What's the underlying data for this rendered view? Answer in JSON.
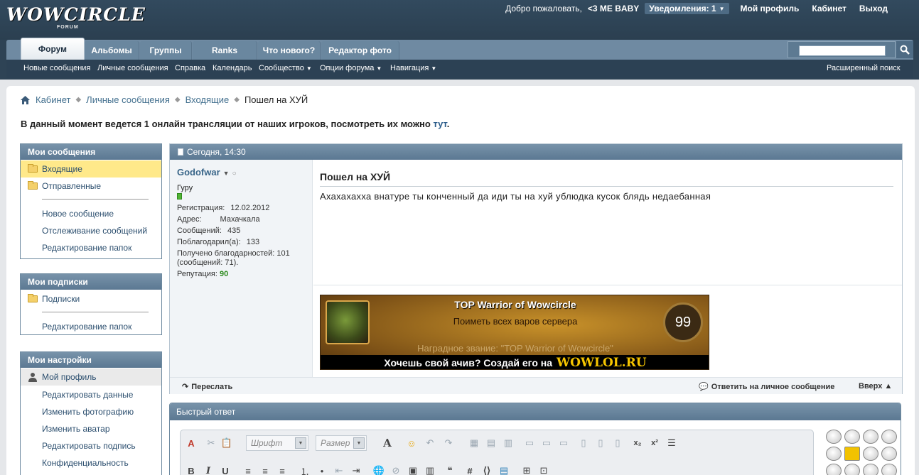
{
  "header": {
    "logo": "WOWCIRCLE",
    "logo_sub": "FORUM",
    "welcome": "Добро пожаловать,",
    "username": "<3 ME BABY",
    "notifications": "Уведомления: 1",
    "my_profile": "Мой профиль",
    "cabinet": "Кабинет",
    "logout": "Выход"
  },
  "tabs": [
    "Форум",
    "Альбомы",
    "Группы",
    "Ranks",
    "Что нового?",
    "Редактор фото"
  ],
  "search": {
    "placeholder": ""
  },
  "subnav": {
    "items": [
      "Новые сообщения",
      "Личные сообщения",
      "Справка",
      "Календарь",
      "Сообщество",
      "Опции форума",
      "Навигация"
    ],
    "advanced_search": "Расширенный поиск"
  },
  "breadcrumb": [
    "Кабинет",
    "Личные сообщения",
    "Входящие",
    "Пошел на ХУЙ"
  ],
  "notice": {
    "text": "В данный момент ведется 1 онлайн трансляции от наших игроков, посмотреть их можно",
    "link": "тут",
    "end": "."
  },
  "sidebar": {
    "messages": {
      "title": "Мои сообщения",
      "folders": [
        "Входящие",
        "Отправленные"
      ],
      "links": [
        "Новое сообщение",
        "Отслеживание сообщений",
        "Редактирование папок"
      ]
    },
    "subscriptions": {
      "title": "Мои подписки",
      "folders": [
        "Подписки"
      ],
      "links": [
        "Редактирование папок"
      ]
    },
    "settings": {
      "title": "Мои настройки",
      "profile": "Мой профиль",
      "links": [
        "Редактировать данные",
        "Изменить фотографию",
        "Изменить аватар",
        "Редактировать подпись",
        "Конфиденциальность"
      ]
    }
  },
  "post": {
    "date": "Сегодня, 14:30",
    "author": "Godofwar",
    "rank": "Гуру",
    "fields": [
      {
        "label": "Регистрация:",
        "value": "12.02.2012"
      },
      {
        "label": "Адрес:",
        "value": "Махачкала"
      },
      {
        "label": "Сообщений:",
        "value": "435"
      },
      {
        "label": "Поблагодарил(а):",
        "value": "133"
      }
    ],
    "thanks_line1": "Получено благодарностей: 101",
    "thanks_line2": "(сообщений: 71).",
    "reputation_label": "Репутация:",
    "reputation_value": "90",
    "title": "Пошел на ХУЙ",
    "text": "Ахахахахха внатуре ты конченный да иди ты на хуй ублюдка кусок блядь недаебанная",
    "signature": {
      "title": "TOP Warrior of Wowcircle",
      "subtitle": "Поиметь всех варов сервера",
      "level": "99",
      "reward": "Наградное звание: \"TOP Warrior of Wowcircle\"",
      "cta": "Хочешь свой ачив? Создай его на",
      "brand": "WOWLOL.RU"
    },
    "forward": "Переслать",
    "reply_private": "Ответить на личное сообщение",
    "up": "Вверх"
  },
  "quick_reply": {
    "title": "Быстрый ответ",
    "font_placeholder": "Шрифт",
    "size_placeholder": "Размер"
  },
  "colors": {
    "header_bg": "#2e4355",
    "tab_bg": "#6f8aa2",
    "block_head": "#5b7892",
    "highlight": "#ffe98a",
    "reputation": "#2e8b1f"
  }
}
